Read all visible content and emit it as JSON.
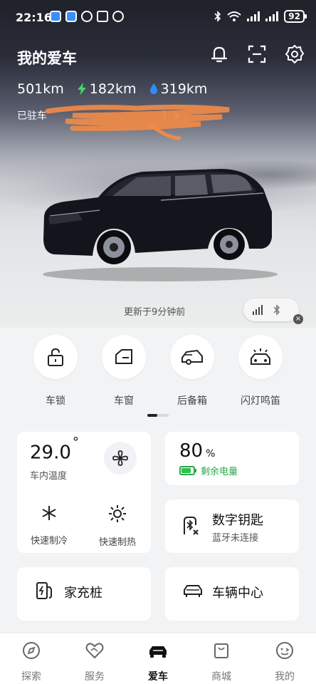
{
  "status_bar": {
    "time": "22:16",
    "battery": "92"
  },
  "header": {
    "title": "我的爱车"
  },
  "ranges": {
    "total": "501km",
    "electric": "182km",
    "fuel": "319km"
  },
  "parked": {
    "prefix": "已驻车",
    "suffix": ")"
  },
  "updated_text": "更新于9分钟前",
  "quick_controls": [
    {
      "label": "车锁",
      "icon": "lock-icon"
    },
    {
      "label": "车窗",
      "icon": "window-icon"
    },
    {
      "label": "后备箱",
      "icon": "trunk-icon"
    },
    {
      "label": "闪灯鸣笛",
      "icon": "flash-horn-icon"
    }
  ],
  "climate": {
    "temperature": "29.0",
    "degree": "°",
    "label": "车内温度",
    "cool_label": "快速制冷",
    "heat_label": "快速制热"
  },
  "battery_card": {
    "value": "80",
    "unit": "%",
    "label": "剩余电量",
    "level": 0.8
  },
  "digital_key": {
    "title": "数字钥匙",
    "subtitle": "蓝牙未连接"
  },
  "home_charger": {
    "title": "家充桩"
  },
  "vehicle_center": {
    "title": "车辆中心"
  },
  "tabs": [
    {
      "label": "探索",
      "active": false
    },
    {
      "label": "服务",
      "active": false
    },
    {
      "label": "爱车",
      "active": true
    },
    {
      "label": "商城",
      "active": false
    },
    {
      "label": "我的",
      "active": false
    }
  ],
  "colors": {
    "accent_green": "#29a84a",
    "electric_green": "#3ddc6a",
    "fuel_blue": "#2f8cff"
  }
}
